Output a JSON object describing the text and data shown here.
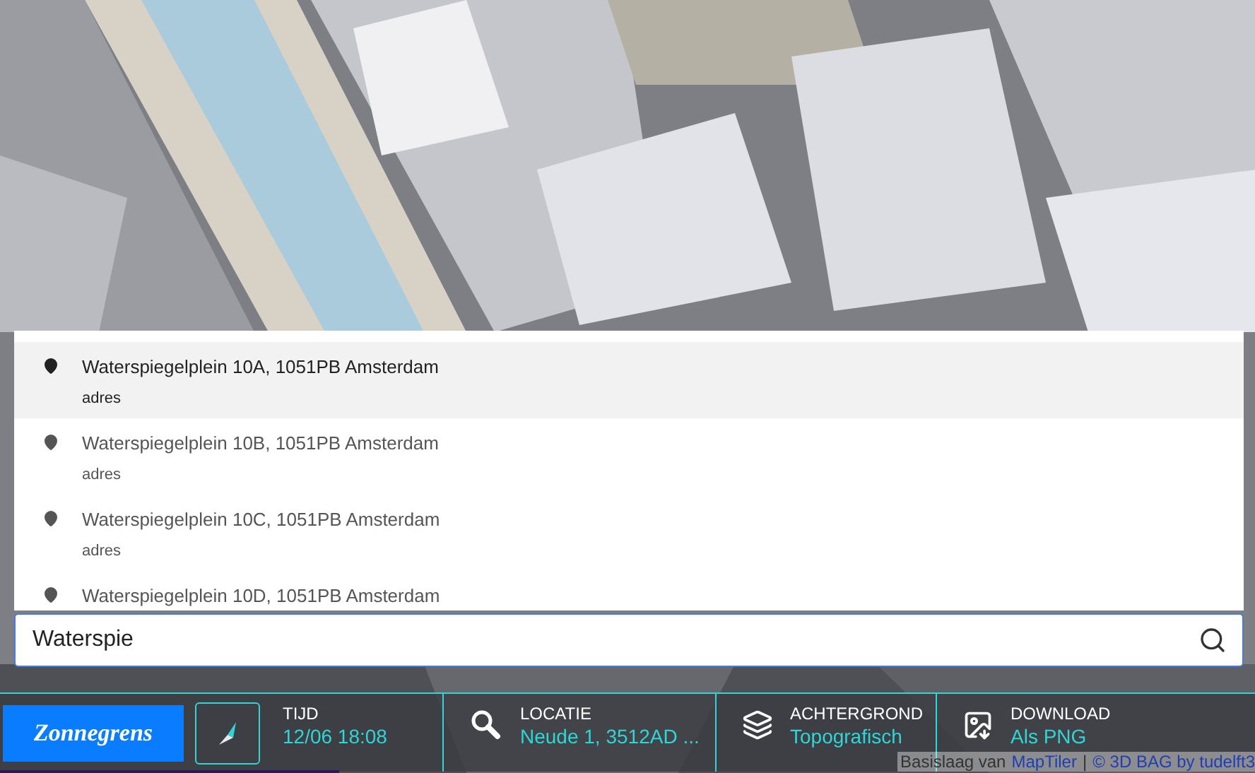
{
  "suggestions": [
    {
      "title": "Waterspiegelplein 10A, 1051PB Amsterdam",
      "subtitle": "adres",
      "selected": true
    },
    {
      "title": "Waterspiegelplein 10B, 1051PB Amsterdam",
      "subtitle": "adres",
      "selected": false
    },
    {
      "title": "Waterspiegelplein 10C, 1051PB Amsterdam",
      "subtitle": "adres",
      "selected": false
    },
    {
      "title": "Waterspiegelplein 10D, 1051PB Amsterdam",
      "selected": false
    }
  ],
  "search": {
    "value": "Waterspie"
  },
  "toolbar": {
    "logo": "Zonnegrens",
    "sections": [
      {
        "kind": "time",
        "label": "TIJD",
        "value": "12/06 18:08"
      },
      {
        "kind": "location",
        "label": "LOCATIE",
        "value": "Neude 1, 3512AD ..."
      },
      {
        "kind": "layers",
        "label": "ACHTERGROND",
        "value": "Topografisch"
      },
      {
        "kind": "download",
        "label": "DOWNLOAD",
        "value": "Als PNG"
      }
    ]
  },
  "attribution": {
    "prefix": "Basislaag van",
    "links": [
      "MapTiler",
      "© 3D BAG by tudelft3"
    ],
    "separator": "|"
  }
}
